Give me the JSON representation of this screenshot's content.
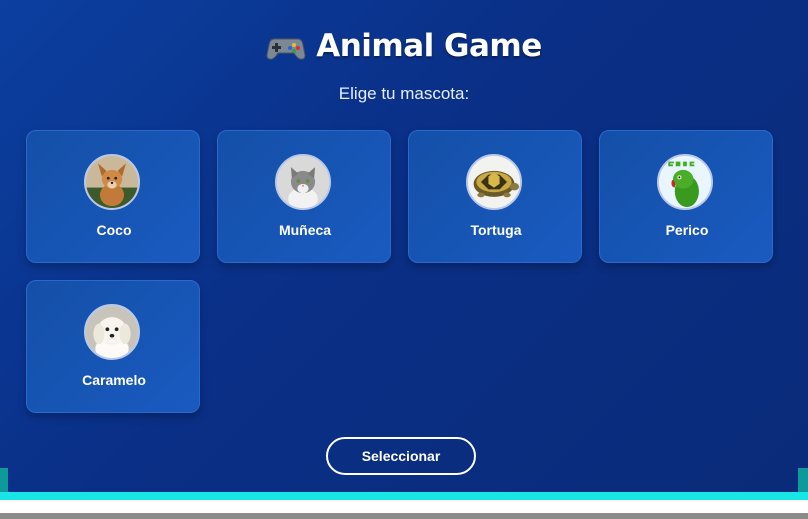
{
  "header": {
    "title": "Animal Game",
    "title_icon": "gamepad-icon",
    "subtitle": "Elige tu mascota:"
  },
  "pets": [
    {
      "name": "Coco",
      "icon": "dog-icon"
    },
    {
      "name": "Muñeca",
      "icon": "cat-icon"
    },
    {
      "name": "Tortuga",
      "icon": "turtle-icon"
    },
    {
      "name": "Perico",
      "icon": "parrot-icon"
    },
    {
      "name": "Caramelo",
      "icon": "puppy-icon"
    }
  ],
  "actions": {
    "select_label": "Seleccionar"
  },
  "colors": {
    "background": "#0a2f86",
    "card": "#1653b4",
    "text": "#ffffff"
  }
}
